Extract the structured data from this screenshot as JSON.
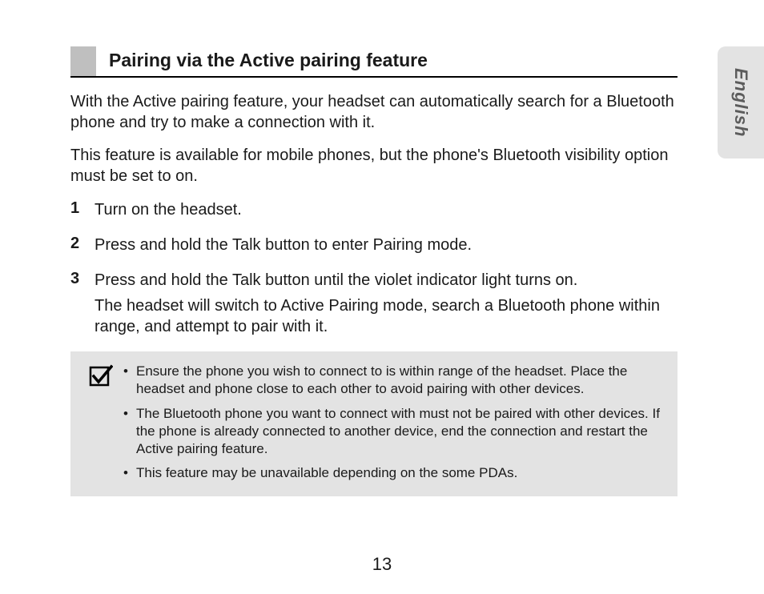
{
  "language_tab": "English",
  "heading": "Pairing via the Active pairing feature",
  "intro": {
    "p1": "With the Active pairing feature, your headset can automatically search for a Bluetooth phone and try to make a connection with it.",
    "p2": "This feature is available for mobile phones, but the phone's Bluetooth visibility option must be set to on."
  },
  "steps": [
    {
      "num": "1",
      "text": "Turn on the headset."
    },
    {
      "num": "2",
      "text": "Press and hold the Talk button to enter Pairing mode."
    },
    {
      "num": "3",
      "text": "Press and hold the Talk button until the violet indicator light turns on.",
      "extra": "The headset will switch to Active Pairing mode, search a Bluetooth phone within range, and attempt to pair with it."
    }
  ],
  "notes": [
    "Ensure the phone you wish to connect to is within range of the headset. Place the headset and phone close to each other to avoid pairing with other devices.",
    "The Bluetooth phone you want to connect with must not be paired with other devices. If the phone is already connected to another device, end the connection and restart the Active pairing feature.",
    "This feature may be unavailable depending on the some PDAs."
  ],
  "page_number": "13"
}
